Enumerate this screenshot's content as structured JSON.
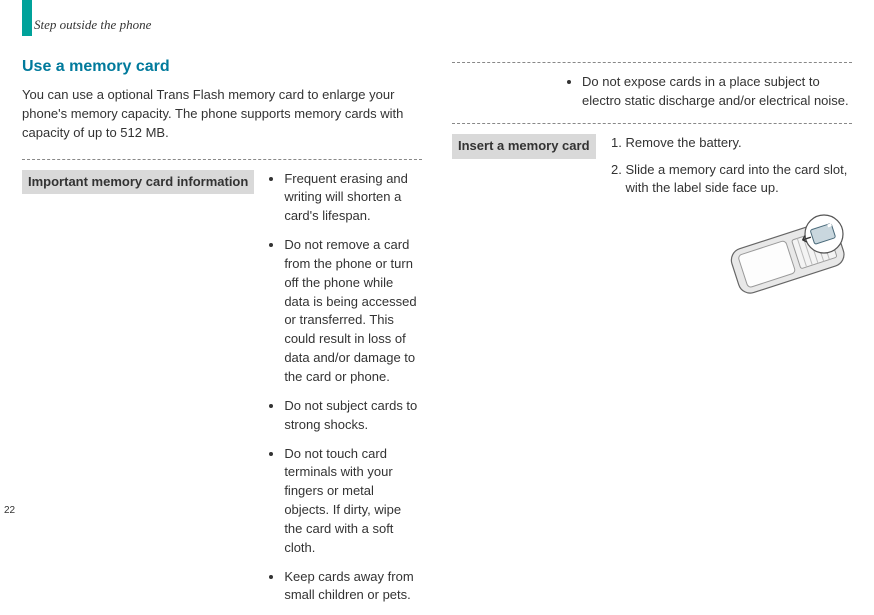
{
  "page": {
    "section_header": "Step outside the phone",
    "number": "22"
  },
  "left": {
    "heading": "Use a memory card",
    "intro": "You can use a optional Trans Flash memory card to enlarge your phone's memory capacity. The phone supports memory cards with capacity of up to 512 MB.",
    "info_label": "Important memory card information",
    "bullets": [
      "Frequent erasing and writing will shorten a card's lifespan.",
      "Do not remove a card from the phone or turn off the phone while data is being accessed or transferred. This could result in loss of data and/or damage to the card or phone.",
      "Do not subject cards to strong shocks.",
      "Do not touch card terminals with your fingers or metal objects. If dirty, wipe the card with a soft cloth.",
      "Keep cards away from small children or pets."
    ]
  },
  "right": {
    "continuation_bullets": [
      "Do not expose cards in a place subject to electro static discharge and/or electrical noise."
    ],
    "insert_label": "Insert a memory card",
    "steps": [
      "Remove the battery.",
      "Slide a memory card into the card slot, with the label side face up."
    ]
  }
}
